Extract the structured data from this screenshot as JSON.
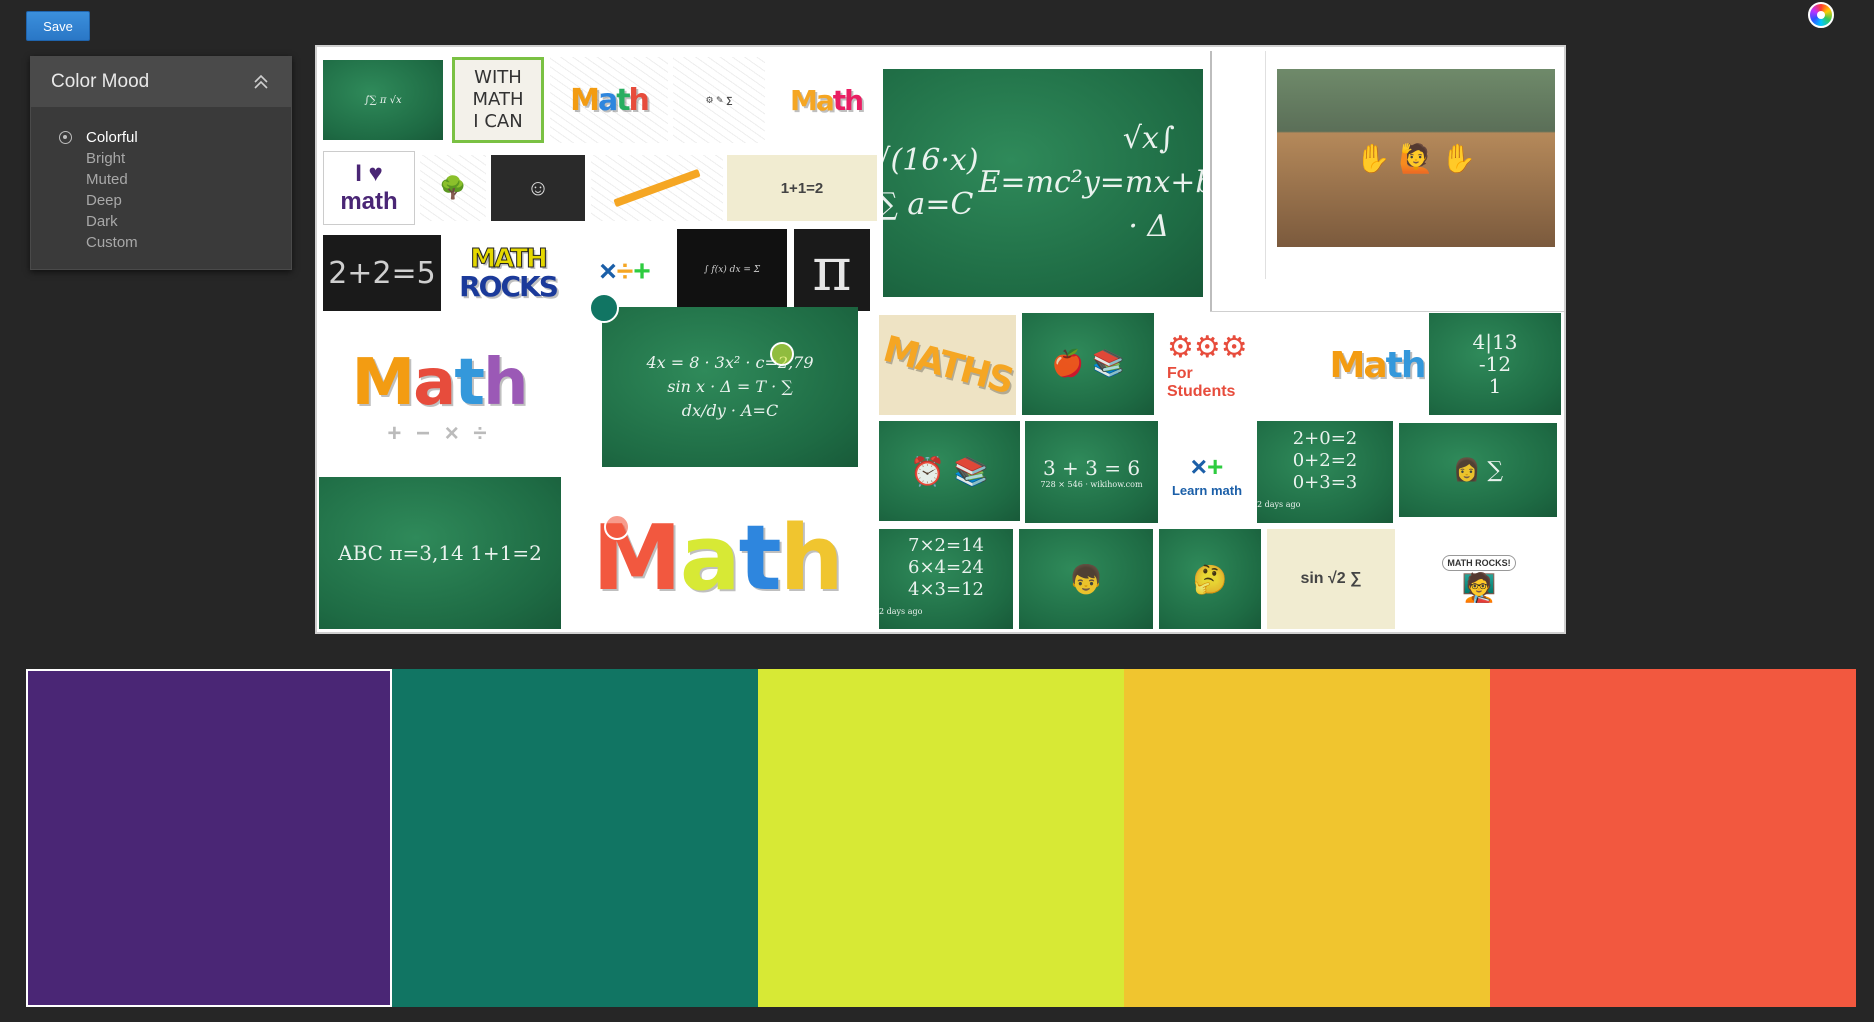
{
  "toolbar": {
    "save_label": "Save"
  },
  "panel": {
    "title": "Color Mood",
    "moods": [
      {
        "label": "Colorful",
        "selected": true
      },
      {
        "label": "Bright",
        "selected": false
      },
      {
        "label": "Muted",
        "selected": false
      },
      {
        "label": "Deep",
        "selected": false
      },
      {
        "label": "Dark",
        "selected": false
      },
      {
        "label": "Custom",
        "selected": false
      }
    ]
  },
  "collage": {
    "texts": {
      "with_math": "WITH\nMATH\nI CAN",
      "math_rocks_1": "MATH",
      "math_rocks_2": "ROCKS",
      "math_big": "Math",
      "math_ops": "+ − × ÷",
      "math_hands": "Math",
      "maths": "MATHS",
      "for_students_1": "For",
      "for_students_2": "Students",
      "learn_math": "Learn math",
      "two_plus_two": "2+2=5",
      "pi": "π",
      "sum_1": "3 + 3 = 6",
      "sum_2": "2+0=2\n0+2=2\n0+3=3",
      "times": "7×2=14\n6×4=24\n4×3=12",
      "emc": "E=mc²",
      "abc": "ABC  π=3,14  1+1=2",
      "one_plus_one": "1+1=2",
      "division": "4|13\n-12\n1",
      "math_rocks_small": "MATH ROCKS!",
      "two_days_1": "2 days ago",
      "two_days_2": "2 days ago",
      "wikihow": "728 × 546 · wikihow.com",
      "i_love": "I ♥ math"
    }
  },
  "palette": {
    "swatches": [
      {
        "color": "#4a2675",
        "selected": true
      },
      {
        "color": "#117563",
        "selected": false
      },
      {
        "color": "#d7e935",
        "selected": false
      },
      {
        "color": "#f0c52f",
        "selected": false
      },
      {
        "color": "#f2583f",
        "selected": false
      }
    ]
  },
  "icons": {
    "color_wheel": "color-wheel-icon",
    "collapse": "chevron-double-up-icon",
    "radio": "radio-selected-icon"
  }
}
